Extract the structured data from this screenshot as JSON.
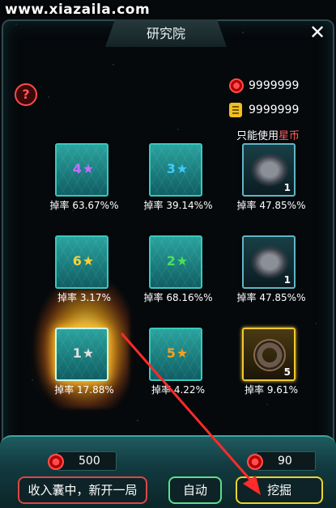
{
  "watermark": "www.xiazaila.com",
  "title": "研究院",
  "help_glyph": "?",
  "close_glyph": "✕",
  "currencies": [
    {
      "icon": "red-coin-icon",
      "value": "9999999"
    },
    {
      "icon": "gold-token-icon",
      "value": "9999999"
    }
  ],
  "note": {
    "prefix": "只能使用",
    "highlight": "星币"
  },
  "cells": [
    {
      "kind": "star",
      "num": "4",
      "star_color": "#c070ff",
      "rate": "掉率 63.67%%"
    },
    {
      "kind": "star",
      "num": "3",
      "star_color": "#40c8ff",
      "rate": "掉率 39.14%%"
    },
    {
      "kind": "item",
      "count": "1",
      "rate": "掉率 47.85%%",
      "item": "spaceship-icon"
    },
    {
      "kind": "star",
      "num": "6",
      "star_color": "#f5d23a",
      "rate": "掉率 3.17%"
    },
    {
      "kind": "star",
      "num": "2",
      "star_color": "#4ae05a",
      "rate": "掉率 68.16%%"
    },
    {
      "kind": "item",
      "count": "1",
      "rate": "掉率 47.85%%",
      "item": "spaceship-icon"
    },
    {
      "kind": "star",
      "num": "1",
      "star_color": "#e0e0e0",
      "rate": "掉率 17.88%",
      "selected": true
    },
    {
      "kind": "star",
      "num": "5",
      "star_color": "#f5a020",
      "rate": "掉率 4.22%"
    },
    {
      "kind": "item",
      "count": "5",
      "rate": "掉率 9.61%",
      "item": "ring-part-icon",
      "gold": true
    }
  ],
  "costs": [
    {
      "value": "500"
    },
    {
      "value": "90"
    }
  ],
  "buttons": {
    "collect": "收入囊中，新开一局",
    "auto": "自动",
    "dig": "挖掘"
  },
  "colors": {
    "accent": "#39c7c0",
    "red": "#e04545",
    "green": "#5ae08a",
    "yellow": "#f0d32a"
  }
}
